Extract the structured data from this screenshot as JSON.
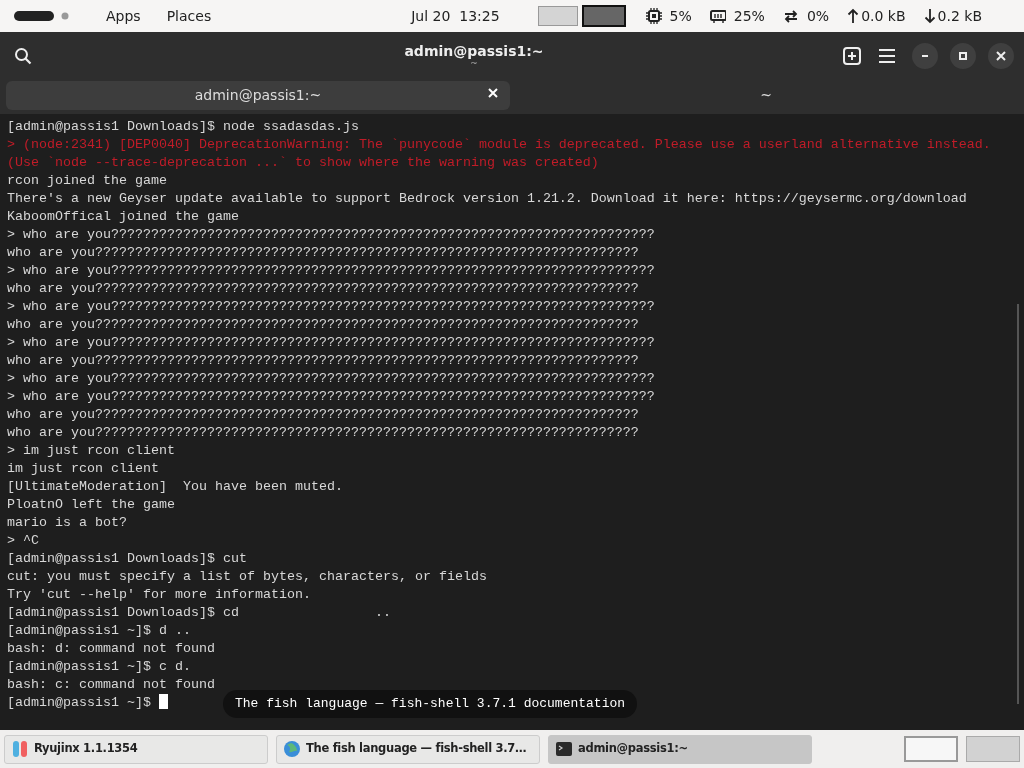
{
  "top_bar": {
    "menus": [
      "Apps",
      "Places"
    ],
    "clock": "Jul 20  13:25",
    "workspaces": [
      {
        "selected": false
      },
      {
        "selected": true
      }
    ],
    "indicators": [
      {
        "kind": "cpu",
        "text": "5%"
      },
      {
        "kind": "memory",
        "text": "25%"
      },
      {
        "kind": "swap",
        "text": "0%"
      },
      {
        "kind": "upload",
        "text": "0.0 kB"
      },
      {
        "kind": "download",
        "text": "0.2 kB"
      }
    ]
  },
  "window": {
    "title": "admin@passis1:~",
    "subtitle": "~"
  },
  "tabs": [
    {
      "label": "admin@passis1:~",
      "selected": true
    },
    {
      "label": "~",
      "selected": false
    }
  ],
  "terminal": {
    "lines": [
      {
        "kind": "normal",
        "text": "[admin@passis1 Downloads]$ node ssadasdas.js"
      },
      {
        "kind": "warning",
        "text": "> (node:2341) [DEP0040] DeprecationWarning: The `punycode` module is deprecated. Please use a userland alternative instead."
      },
      {
        "kind": "warning",
        "text": "(Use `node --trace-deprecation ...` to show where the warning was created)"
      },
      {
        "kind": "normal",
        "text": "rcon joined the game"
      },
      {
        "kind": "normal",
        "text": "There's a new Geyser update available to support Bedrock version 1.21.2. Download it here: https://geysermc.org/download"
      },
      {
        "kind": "normal",
        "text": "KaboomOffical joined the game"
      },
      {
        "kind": "normal",
        "text": "> who are you????????????????????????????????????????????????????????????????????"
      },
      {
        "kind": "normal",
        "text": "who are you????????????????????????????????????????????????????????????????????"
      },
      {
        "kind": "normal",
        "text": "> who are you????????????????????????????????????????????????????????????????????"
      },
      {
        "kind": "normal",
        "text": "who are you????????????????????????????????????????????????????????????????????"
      },
      {
        "kind": "normal",
        "text": "> who are you????????????????????????????????????????????????????????????????????"
      },
      {
        "kind": "normal",
        "text": "who are you????????????????????????????????????????????????????????????????????"
      },
      {
        "kind": "normal",
        "text": "> who are you????????????????????????????????????????????????????????????????????"
      },
      {
        "kind": "normal",
        "text": "who are you????????????????????????????????????????????????????????????????????"
      },
      {
        "kind": "normal",
        "text": "> who are you????????????????????????????????????????????????????????????????????"
      },
      {
        "kind": "normal",
        "text": "> who are you????????????????????????????????????????????????????????????????????"
      },
      {
        "kind": "normal",
        "text": "who are you????????????????????????????????????????????????????????????????????"
      },
      {
        "kind": "normal",
        "text": "who are you????????????????????????????????????????????????????????????????????"
      },
      {
        "kind": "normal",
        "text": "> im just rcon client"
      },
      {
        "kind": "normal",
        "text": "im just rcon client"
      },
      {
        "kind": "normal",
        "text": "[UltimateModeration]  You have been muted."
      },
      {
        "kind": "normal",
        "text": "PloatnO left the game"
      },
      {
        "kind": "normal",
        "text": "mario is a bot?"
      },
      {
        "kind": "normal",
        "text": "> ^C"
      },
      {
        "kind": "normal",
        "text": "[admin@passis1 Downloads]$ cut"
      },
      {
        "kind": "normal",
        "text": "cut: you must specify a list of bytes, characters, or fields"
      },
      {
        "kind": "normal",
        "text": "Try 'cut --help' for more information."
      },
      {
        "kind": "normal",
        "text": "[admin@passis1 Downloads]$ cd                 .."
      },
      {
        "kind": "normal",
        "text": "[admin@passis1 ~]$ d .."
      },
      {
        "kind": "normal",
        "text": "bash: d: command not found"
      },
      {
        "kind": "normal",
        "text": "[admin@passis1 ~]$ c d."
      },
      {
        "kind": "normal",
        "text": "bash: c: command not found"
      },
      {
        "kind": "prompt",
        "text": "[admin@passis1 ~]$ "
      }
    ]
  },
  "tooltip": "The fish language — fish-shell 3.7.1 documentation",
  "taskbar": {
    "windows": [
      {
        "kind": "game",
        "label": "Ryujinx 1.1.1354",
        "selected": false
      },
      {
        "kind": "browser",
        "label": "The fish language — fish-shell 3.7…",
        "selected": false
      },
      {
        "kind": "terminal",
        "label": "admin@passis1:~",
        "selected": true
      }
    ],
    "workspaces": [
      {
        "selected": true
      },
      {
        "selected": false
      }
    ]
  }
}
